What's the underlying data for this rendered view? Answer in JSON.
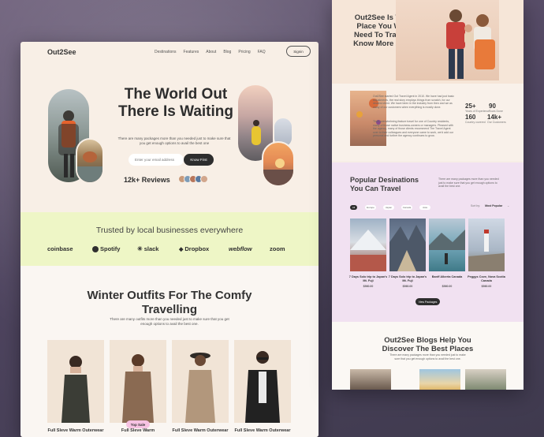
{
  "nav": {
    "logo": "Out2See",
    "links": [
      "Destinations",
      "Features",
      "About",
      "Blog",
      "Pricing",
      "FAQ"
    ],
    "signin": "Signin"
  },
  "hero": {
    "title": "The World Out There Is Waiting",
    "subtitle": "There are many packages more than you needed just to make sure that you get enough options to avail the best one",
    "email_placeholder": "Enter your email address",
    "cta": "Know First",
    "reviews": "12k+ Reviews"
  },
  "trusted": {
    "title": "Trusted by local businesses everywhere",
    "brands": [
      "coinbase",
      "Spotify",
      "slack",
      "Dropbox",
      "webflow",
      "zoom"
    ]
  },
  "winter": {
    "title": "Winter Outfits For The Comfy Travelling",
    "subtitle": "There are many outfits more than you needed just to make sure that you get enough options to avail the best one.",
    "tag": "Top Sale",
    "cards": [
      "Full Sleve Warm Outerwear",
      "Full Sleve Warm",
      "Full Sleve Warm Outerwear",
      "Full Sleve Warm Outerwear"
    ]
  },
  "side": {
    "headline": "Out2See Is The Only Place You Will Ever Need To Travel. Let's Know More About Us",
    "about_p1": "Out2See started Out Travel Agent in 2010. We have had just basic adjustments, the real story employs things from scratch, for our dearest client. We have been in the industry from then and we as many of our customers when everything is mostly done.",
    "about_p2": "Their overwhelming feature travel for one of Country residents, many of those native business-owners or managers. Pleased with the agency, many of those clients recommend The Travel Agent over to their colleagues and everyone came to work, we'd add our personal and further the agency continues to grow.",
    "stats": [
      {
        "value": "25+",
        "label": "Years of Experience"
      },
      {
        "value": "90",
        "label": "Tours Done"
      },
      {
        "value": "160",
        "label": "Country covered"
      },
      {
        "value": "14k+",
        "label": "Our Customers"
      }
    ],
    "popular_title": "Popular Desinations You Can Travel",
    "popular_sub": "There are many packages more than you needed just to make sure that you get enough options to avail the best one.",
    "filters": [
      "All",
      "Europe",
      "Japan",
      "Canada",
      "Asia"
    ],
    "sort_label": "Sort by:",
    "sort_value": "Most Popular",
    "destinations": [
      {
        "name": "7 Days Solo trip to Japan's Mt. Fuji",
        "price": "$560.00"
      },
      {
        "name": "7 Days Solo trip to Japan's Mt. Fuji",
        "price": "$560.00"
      },
      {
        "name": "Banff Alberta Canada",
        "price": "$560.00"
      },
      {
        "name": "Peggys Cove, Nova Scotia Canada",
        "price": "$560.00"
      }
    ],
    "view_packages": "View Packages",
    "blogs_title": "Out2See Blogs Help You Discover The Best Places",
    "blogs_sub": "There are many packages more than you needed just to make sure that you get enough options to avail the best one."
  },
  "colors": {
    "accent": "#2d2d2d",
    "trusted_bg": "#eef6c6",
    "popular_bg": "#f1e1f1",
    "tag": "#f6c2e2"
  }
}
